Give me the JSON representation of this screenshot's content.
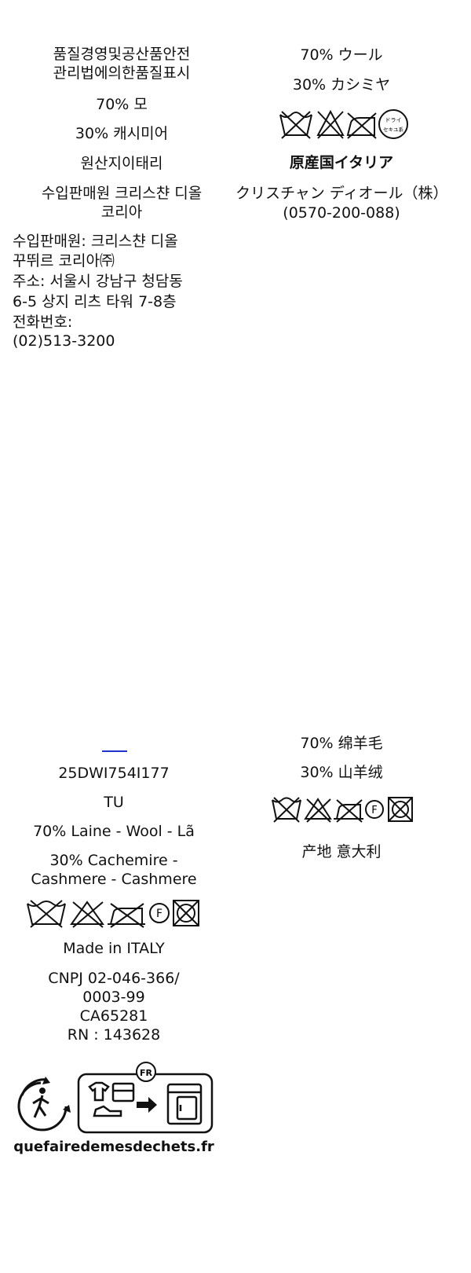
{
  "korean": {
    "title_line1": "품질경영및공산품안전",
    "title_line2": "관리법에의한품질표시",
    "fiber1": "70% 모",
    "fiber2": "30% 캐시미어",
    "origin": "원산지이태리",
    "importer_line1": "수입판매원 크리스챤 디올",
    "importer_line2": "코리아",
    "details_line1": "수입판매원: 크리스챤 디올",
    "details_line2": "꾸뛰르 코리아㈜",
    "details_line3": "주소: 서울시 강남구 청담동",
    "details_line4": "6-5 상지 리츠 타워 7-8층",
    "details_line5": "전화번호:",
    "details_line6": "(02)513-3200"
  },
  "japanese": {
    "fiber1": "70% ウール",
    "fiber2": "30% カシミヤ",
    "origin": "原産国イタリア",
    "company": "クリスチャン ディオール（株）",
    "phone": "(0570-200-088)",
    "care_icon_names": [
      "wash-tub-crossed-icon",
      "bleach-crossed-icon",
      "iron-crossed-icon",
      "dry-clean-icon"
    ],
    "dry_clean_symbol_text_top": "ドライ",
    "dry_clean_symbol_text_bottom": "セキユ系"
  },
  "international": {
    "style_code": "25DWI754I177",
    "size": "TU",
    "fiber1": "70% Laine - Wool - Lã",
    "fiber2_line1": "30% Cachemire -",
    "fiber2_line2": "Cashmere - Cashmere",
    "made_in": "Made in ITALY",
    "cnpj_line1": "CNPJ  02-046-366/",
    "cnpj_line2": "0003-99",
    "ca": "CA65281",
    "rn": "RN : 143628",
    "care_icon_names": [
      "wash-tub-crossed-icon",
      "bleach-crossed-icon",
      "tumble-dry-crossed-icon",
      "professional-clean-f-icon",
      "dryer-crossed-icon"
    ],
    "professional_clean_letter": "F",
    "fr_badge": "FR",
    "website": "quefairedemesdechets.fr"
  },
  "chinese": {
    "fiber1": "70% 绵羊毛",
    "fiber2": "30% 山羊绒",
    "origin": "产地 意大利",
    "care_icon_names": [
      "wash-tub-crossed-icon",
      "bleach-crossed-icon",
      "tumble-dry-crossed-icon",
      "professional-clean-f-icon",
      "dryer-crossed-icon"
    ],
    "professional_clean_letter": "F"
  },
  "colors": {
    "text": "#111111",
    "accent_line": "#2233cc",
    "background": "#ffffff"
  }
}
